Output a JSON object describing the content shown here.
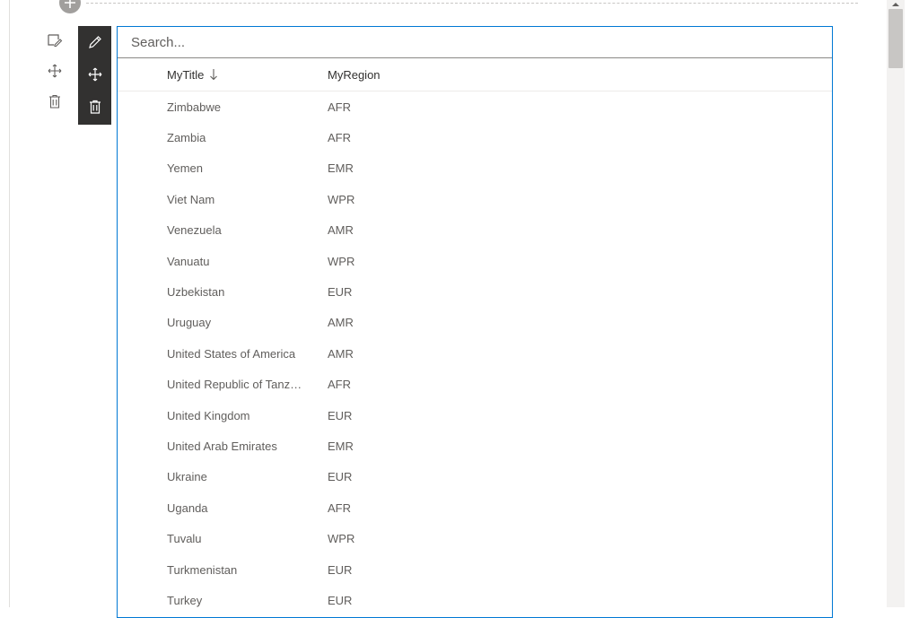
{
  "search": {
    "placeholder": "Search..."
  },
  "side_toolbar": {
    "edit_icon": "edit-icon",
    "move_icon": "move-icon",
    "delete_icon": "delete-icon"
  },
  "dark_toolbar": {
    "edit_icon": "pencil-icon",
    "move_icon": "move-icon",
    "delete_icon": "trash-icon"
  },
  "columns": {
    "title": "MyTitle",
    "region": "MyRegion",
    "sort_icon": "sort-descending-arrow-icon"
  },
  "rows": [
    {
      "title": "Zimbabwe",
      "region": "AFR"
    },
    {
      "title": "Zambia",
      "region": "AFR"
    },
    {
      "title": "Yemen",
      "region": "EMR"
    },
    {
      "title": "Viet Nam",
      "region": "WPR"
    },
    {
      "title": "Venezuela",
      "region": "AMR"
    },
    {
      "title": "Vanuatu",
      "region": "WPR"
    },
    {
      "title": "Uzbekistan",
      "region": "EUR"
    },
    {
      "title": "Uruguay",
      "region": "AMR"
    },
    {
      "title": "United States of America",
      "region": "AMR"
    },
    {
      "title": "United Republic of Tanza...",
      "region": "AFR"
    },
    {
      "title": "United Kingdom",
      "region": "EUR"
    },
    {
      "title": "United Arab Emirates",
      "region": "EMR"
    },
    {
      "title": "Ukraine",
      "region": "EUR"
    },
    {
      "title": "Uganda",
      "region": "AFR"
    },
    {
      "title": "Tuvalu",
      "region": "WPR"
    },
    {
      "title": "Turkmenistan",
      "region": "EUR"
    },
    {
      "title": "Turkey",
      "region": "EUR"
    }
  ],
  "colors": {
    "accent": "#0078d4",
    "toolbar_dark": "#323130",
    "text_secondary": "#605e5c"
  }
}
